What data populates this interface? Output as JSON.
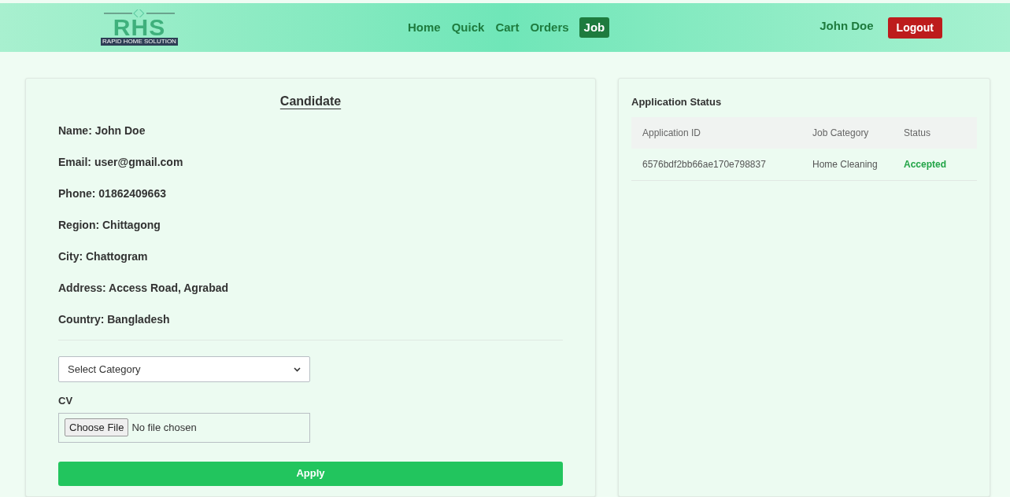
{
  "header": {
    "logo": {
      "letters": "RHS",
      "tagline": "RAPID HOME SOLUTION"
    },
    "nav": [
      {
        "label": "Home",
        "selected": false
      },
      {
        "label": "Quick",
        "selected": false
      },
      {
        "label": "Cart",
        "selected": false
      },
      {
        "label": "Orders",
        "selected": false
      },
      {
        "label": "Job",
        "selected": true
      }
    ],
    "user": "John Doe",
    "logout": "Logout"
  },
  "candidate": {
    "title": "Candidate",
    "details": [
      "Name: John Doe",
      "Email: user@gmail.com",
      "Phone: 01862409663",
      "Region: Chittagong",
      "City: Chattogram",
      "Address: Access Road, Agrabad",
      "Country: Bangladesh"
    ],
    "category_select": {
      "value": "Select Category"
    },
    "cv_label": "CV",
    "file_button": "Choose File",
    "file_status": "No file chosen",
    "apply": "Apply"
  },
  "status_panel": {
    "title": "Application Status",
    "columns": [
      "Application ID",
      "Job Category",
      "Status"
    ],
    "rows": [
      [
        "6576bdf2bb66ae170e798837",
        "Home Cleaning",
        "Accepted"
      ]
    ]
  }
}
